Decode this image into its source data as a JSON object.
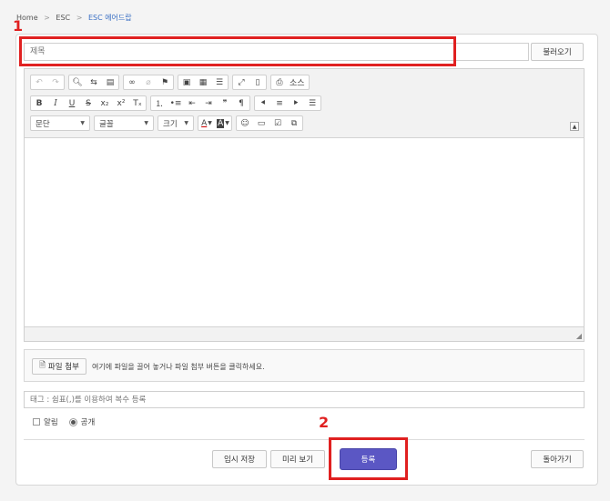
{
  "breadcrumb": {
    "home": "Home",
    "sep": ">",
    "level1": "ESC",
    "current": "ESC 에어드랍"
  },
  "title_field": {
    "placeholder": "제목"
  },
  "load_button": "불러오기",
  "toolbar": {
    "row1": [
      {
        "name": "undo-icon",
        "glyph": "↶",
        "disabled": true
      },
      {
        "name": "redo-icon",
        "glyph": "↷",
        "disabled": true
      },
      {
        "name": "find-icon",
        "glyph": "🔍︎"
      },
      {
        "name": "replace-icon",
        "glyph": "⇆"
      },
      {
        "name": "select-all-icon",
        "glyph": "▤"
      },
      {
        "name": "link-icon",
        "glyph": "∞"
      },
      {
        "name": "unlink-icon",
        "glyph": "⌀",
        "disabled": true
      },
      {
        "name": "anchor-flag-icon",
        "glyph": "⚑"
      },
      {
        "name": "image-icon",
        "glyph": "▣"
      },
      {
        "name": "table-icon",
        "glyph": "▦"
      },
      {
        "name": "horizontal-line-icon",
        "glyph": "☰"
      },
      {
        "name": "maximize-icon",
        "glyph": "⤢"
      },
      {
        "name": "show-blocks-icon",
        "glyph": "▯"
      },
      {
        "name": "source-icon",
        "glyph": "⎙"
      }
    ],
    "source_label": "소스",
    "row2": [
      {
        "name": "bold-icon",
        "glyph": "B"
      },
      {
        "name": "italic-icon",
        "glyph": "I"
      },
      {
        "name": "underline-icon",
        "glyph": "U"
      },
      {
        "name": "strikethrough-icon",
        "glyph": "S"
      },
      {
        "name": "subscript-icon",
        "glyph": "x₂"
      },
      {
        "name": "superscript-icon",
        "glyph": "x²"
      },
      {
        "name": "remove-format-icon",
        "glyph": "Tₓ"
      },
      {
        "name": "numbered-list-icon",
        "glyph": "⒈"
      },
      {
        "name": "bulleted-list-icon",
        "glyph": "•≡"
      },
      {
        "name": "outdent-icon",
        "glyph": "⇤"
      },
      {
        "name": "indent-icon",
        "glyph": "⇥"
      },
      {
        "name": "blockquote-icon",
        "glyph": "❞"
      },
      {
        "name": "bidi-icon",
        "glyph": "¶"
      },
      {
        "name": "align-left-icon",
        "glyph": "⯇"
      },
      {
        "name": "align-center-icon",
        "glyph": "≡"
      },
      {
        "name": "align-right-icon",
        "glyph": "⯈"
      },
      {
        "name": "justify-icon",
        "glyph": "☰"
      }
    ],
    "format_combo": "문단",
    "font_combo": "글꼴",
    "size_combo": "크기",
    "text_color_glyph": "A",
    "bg_color_glyph": "A",
    "row3_icons": [
      {
        "name": "emoji-icon",
        "glyph": "☺"
      },
      {
        "name": "media-icon",
        "glyph": "▭"
      },
      {
        "name": "checkbox-icon",
        "glyph": "☑"
      },
      {
        "name": "embed-icon",
        "glyph": "⧉"
      }
    ]
  },
  "attach": {
    "button_label": "파일 첨부",
    "hint": "여기에 파일을 끌어 놓거나 파일 첨부 버튼을 클릭하세요."
  },
  "tag_field": {
    "placeholder": "태그 : 쉼표(,)를 이용하여 복수 등록"
  },
  "options": {
    "notify_label": "알림",
    "public_label": "공개"
  },
  "buttons": {
    "temp_save": "임시 저장",
    "preview": "미리 보기",
    "submit": "등록",
    "back": "돌아가기"
  },
  "annotations": {
    "marker1": "1",
    "marker2": "2"
  },
  "colors": {
    "accent": "#5b57c4",
    "highlight": "#e02020",
    "breadcrumb_current": "#3a6fc4"
  }
}
